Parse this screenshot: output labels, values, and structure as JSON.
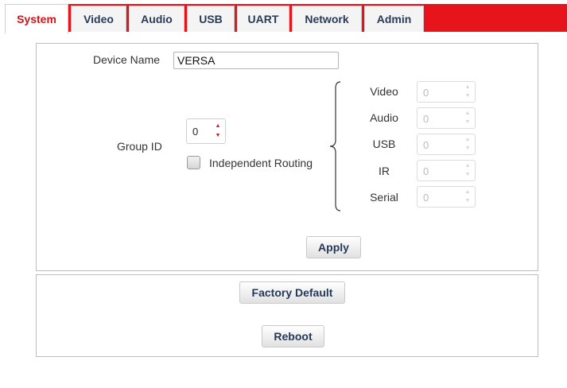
{
  "tabs": [
    {
      "label": "System"
    },
    {
      "label": "Video"
    },
    {
      "label": "Audio"
    },
    {
      "label": "USB"
    },
    {
      "label": "UART"
    },
    {
      "label": "Network"
    },
    {
      "label": "Admin"
    }
  ],
  "active_tab": "System",
  "colors": {
    "accent": "#e8141b",
    "tab_text": "#2a3b56",
    "active_tab_text": "#d0141a"
  },
  "system": {
    "device_name_label": "Device Name",
    "device_name_value": "VERSA",
    "group_id_label": "Group ID",
    "group_id_value": "0",
    "independent_routing_label": "Independent Routing",
    "independent_routing_checked": false,
    "routing": [
      {
        "label": "Video",
        "value": "0"
      },
      {
        "label": "Audio",
        "value": "0"
      },
      {
        "label": "USB",
        "value": "0"
      },
      {
        "label": "IR",
        "value": "0"
      },
      {
        "label": "Serial",
        "value": "0"
      }
    ],
    "apply_label": "Apply"
  },
  "maintenance": {
    "factory_default_label": "Factory Default",
    "reboot_label": "Reboot"
  }
}
